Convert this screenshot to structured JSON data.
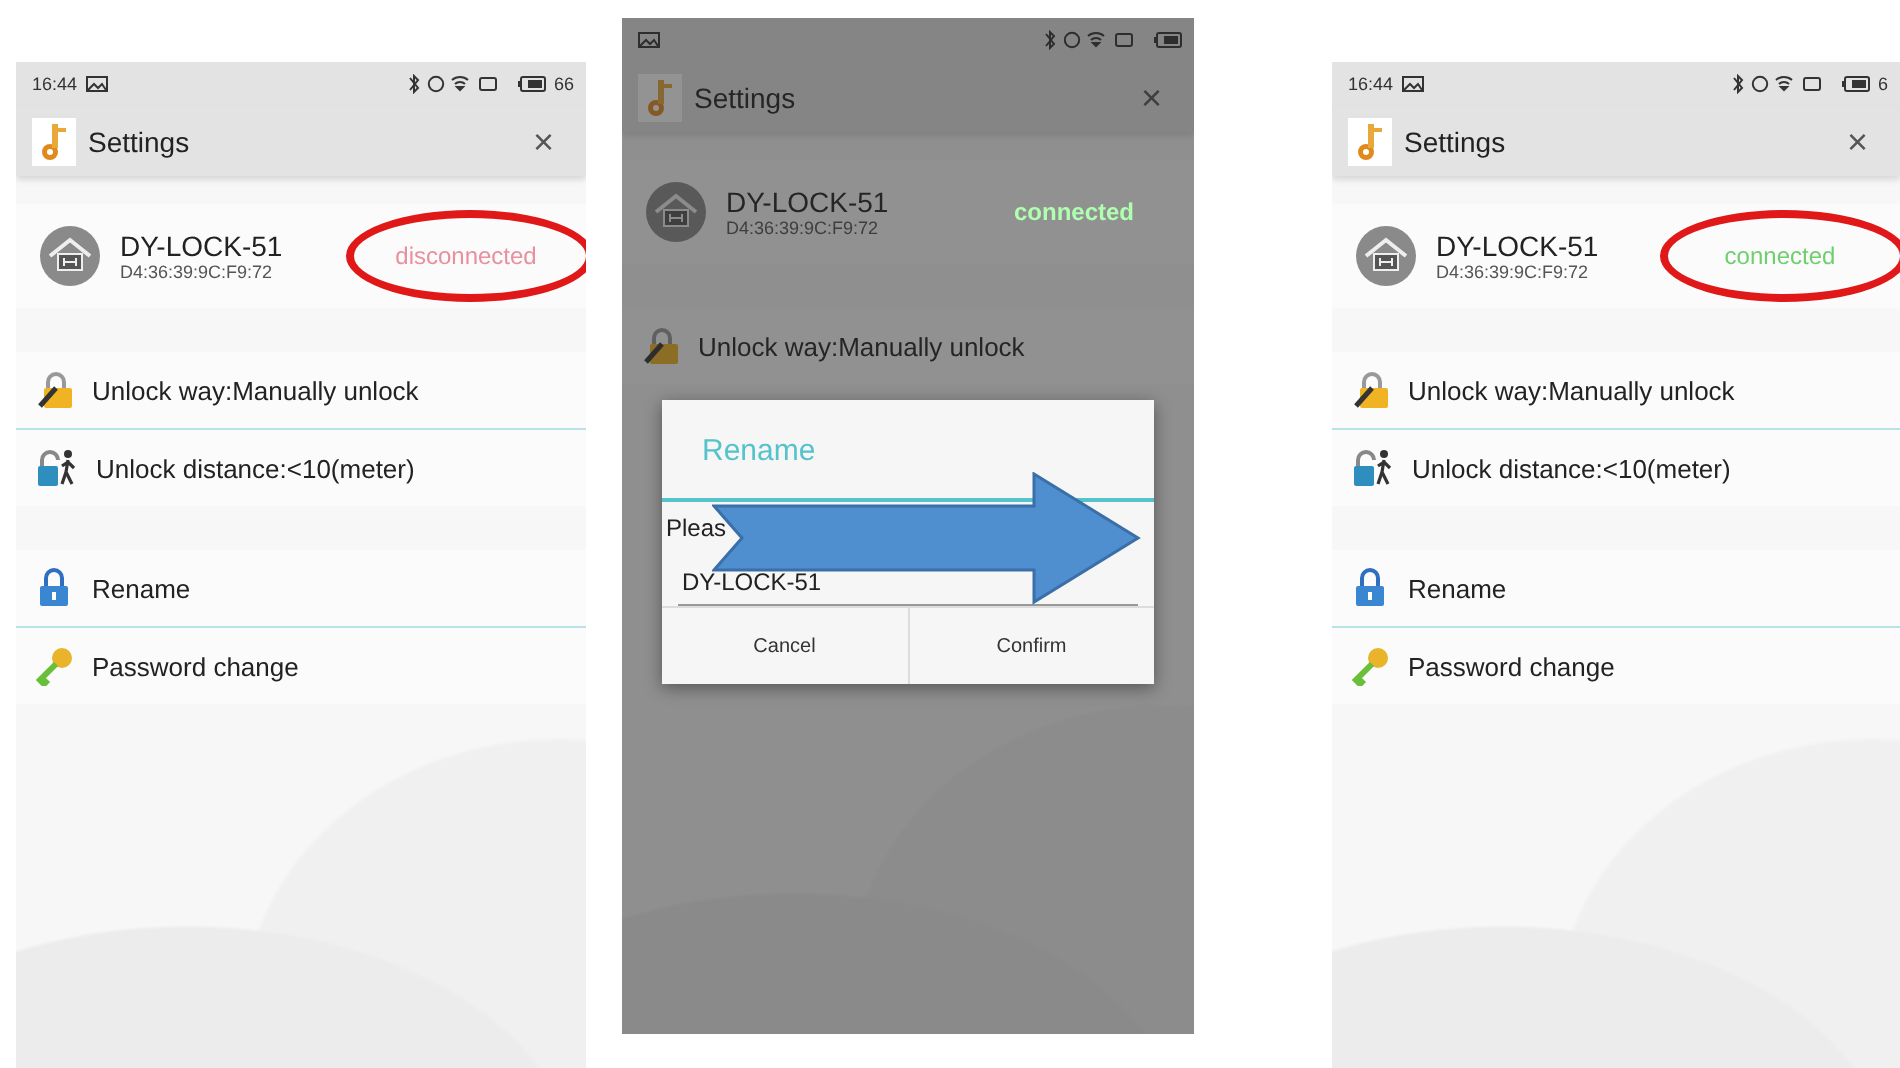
{
  "screens": [
    {
      "status_bar": {
        "time": "16:44",
        "battery": "66"
      },
      "title": "Settings",
      "close": "×",
      "device": {
        "name": "DY-LOCK-51",
        "mac": "D4:36:39:9C:F9:72",
        "status": "disconnected",
        "connected": false,
        "circled": true
      },
      "sections": [
        {
          "items": [
            {
              "kind": "wrench-lock",
              "label": "Unlock way:Manually unlock"
            },
            {
              "kind": "walk-lock",
              "label": "Unlock distance:<10(meter)"
            }
          ]
        },
        {
          "items": [
            {
              "kind": "lock",
              "label": "Rename"
            },
            {
              "kind": "key",
              "label": "Password change"
            }
          ]
        }
      ]
    },
    {
      "dimmed": true,
      "title": "Settings",
      "close": "×",
      "device": {
        "name": "DY-LOCK-51",
        "mac": "D4:36:39:9C:F9:72",
        "status": "connected",
        "connected": true
      },
      "sections": [
        {
          "items": [
            {
              "kind": "wrench-lock",
              "label": "Unlock way:Manually unlock"
            }
          ]
        }
      ],
      "dialog": {
        "title": "Rename",
        "prompt": "Pleas",
        "value": "DY-LOCK-51",
        "buttons": [
          "Cancel",
          "Confirm"
        ],
        "arrow": true
      }
    },
    {
      "status_bar": {
        "time": "16:44",
        "battery": "6"
      },
      "title": "Settings",
      "close": "×",
      "device": {
        "name": "DY-LOCK-51",
        "mac": "D4:36:39:9C:F9:72",
        "status": "connected",
        "connected": true,
        "circled": true
      },
      "sections": [
        {
          "items": [
            {
              "kind": "wrench-lock",
              "label": "Unlock way:Manually unlock"
            },
            {
              "kind": "walk-lock",
              "label": "Unlock distance:<10(meter)"
            }
          ]
        },
        {
          "items": [
            {
              "kind": "lock",
              "label": "Rename"
            },
            {
              "kind": "key",
              "label": "Password change"
            }
          ]
        }
      ]
    }
  ]
}
